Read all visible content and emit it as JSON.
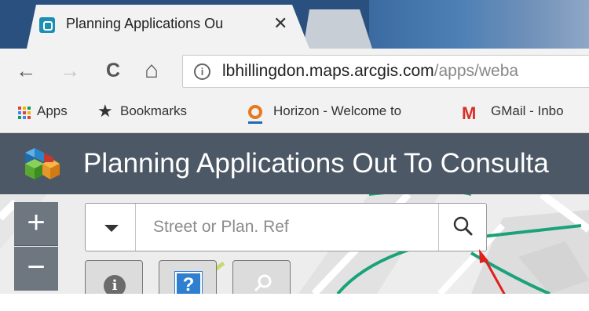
{
  "browser": {
    "active_tab_title": "Planning Applications Ou",
    "tab_close_glyph": "✕",
    "nav": {
      "back": "←",
      "forward": "→",
      "reload": "C",
      "home": "⌂"
    },
    "url_host": "lbhillingdon.maps.arcgis.com",
    "url_path": "/apps/weba",
    "bookmarks": [
      {
        "label": "Apps",
        "icon": "apps-grid-icon"
      },
      {
        "label": "Bookmarks",
        "icon": "star-icon"
      },
      {
        "label": "Horizon - Welcome to",
        "icon": "horizon-icon"
      },
      {
        "label": "GMail - Inbo",
        "icon": "gmail-icon"
      }
    ]
  },
  "app": {
    "title": "Planning Applications Out To Consulta",
    "logo_icon": "cubes-logo-icon",
    "colors": {
      "header": "#4c5865",
      "road_green": "#1aa37a",
      "annotation": "#e0201b"
    }
  },
  "map": {
    "zoom_in": "+",
    "zoom_out": "−",
    "search_placeholder": "Street or Plan. Ref",
    "tools": [
      {
        "icon": "info-icon",
        "glyph": "i"
      },
      {
        "icon": "help-icon",
        "glyph": "?"
      },
      {
        "icon": "locate-icon"
      }
    ]
  }
}
